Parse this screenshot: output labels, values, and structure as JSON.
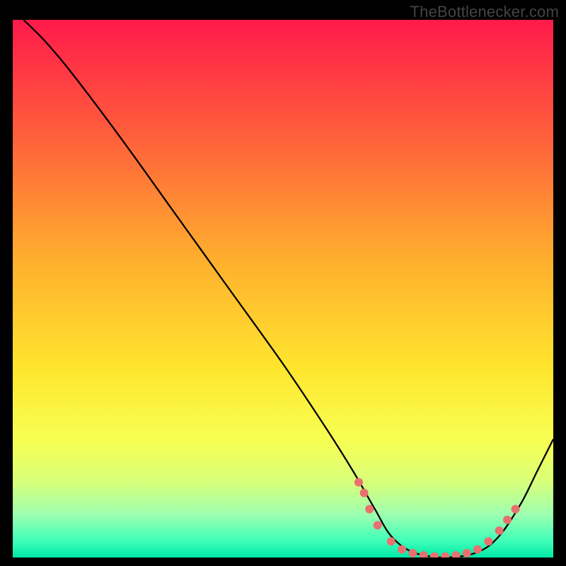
{
  "watermark": "TheBottlenecker.com",
  "chart_data": {
    "type": "line",
    "title": "",
    "xlabel": "",
    "ylabel": "",
    "xlim": [
      0,
      100
    ],
    "ylim": [
      0,
      100
    ],
    "background_gradient": {
      "direction": "vertical",
      "stops": [
        {
          "pct": 0,
          "color": "#ff1a4b"
        },
        {
          "pct": 20,
          "color": "#ff5a3c"
        },
        {
          "pct": 45,
          "color": "#ffb02e"
        },
        {
          "pct": 65,
          "color": "#ffe62e"
        },
        {
          "pct": 78,
          "color": "#f7ff52"
        },
        {
          "pct": 86,
          "color": "#d8ff7a"
        },
        {
          "pct": 92,
          "color": "#9dffb0"
        },
        {
          "pct": 97,
          "color": "#3dffb8"
        },
        {
          "pct": 100,
          "color": "#00e8a8"
        }
      ]
    },
    "series": [
      {
        "name": "bottleneck-curve",
        "color": "#000000",
        "values": [
          {
            "x": 2,
            "y": 100
          },
          {
            "x": 6,
            "y": 96
          },
          {
            "x": 11,
            "y": 90
          },
          {
            "x": 20,
            "y": 78
          },
          {
            "x": 30,
            "y": 64
          },
          {
            "x": 40,
            "y": 50
          },
          {
            "x": 50,
            "y": 36
          },
          {
            "x": 58,
            "y": 24
          },
          {
            "x": 63,
            "y": 16
          },
          {
            "x": 67,
            "y": 9
          },
          {
            "x": 70,
            "y": 4
          },
          {
            "x": 74,
            "y": 1
          },
          {
            "x": 80,
            "y": 0
          },
          {
            "x": 86,
            "y": 1
          },
          {
            "x": 90,
            "y": 4
          },
          {
            "x": 94,
            "y": 10
          },
          {
            "x": 97,
            "y": 16
          },
          {
            "x": 100,
            "y": 22
          }
        ]
      }
    ],
    "markers": {
      "name": "highlight-dots",
      "color": "#e9706f",
      "radius": 6,
      "points": [
        {
          "x": 64,
          "y": 14
        },
        {
          "x": 65,
          "y": 12
        },
        {
          "x": 66,
          "y": 9
        },
        {
          "x": 67.5,
          "y": 6
        },
        {
          "x": 70,
          "y": 3
        },
        {
          "x": 72,
          "y": 1.5
        },
        {
          "x": 74,
          "y": 0.8
        },
        {
          "x": 76,
          "y": 0.4
        },
        {
          "x": 78,
          "y": 0.2
        },
        {
          "x": 80,
          "y": 0.2
        },
        {
          "x": 82,
          "y": 0.4
        },
        {
          "x": 84,
          "y": 0.8
        },
        {
          "x": 86,
          "y": 1.5
        },
        {
          "x": 88,
          "y": 3
        },
        {
          "x": 90,
          "y": 5
        },
        {
          "x": 91.5,
          "y": 7
        },
        {
          "x": 93,
          "y": 9
        }
      ]
    }
  }
}
